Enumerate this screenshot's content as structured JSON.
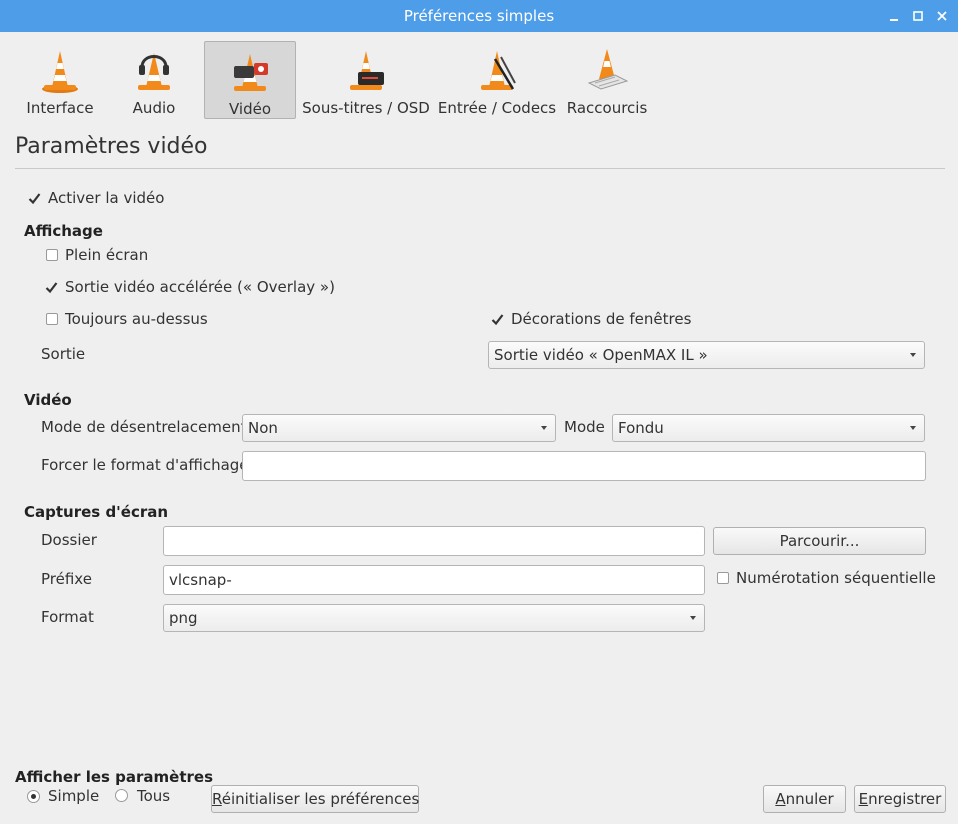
{
  "window": {
    "title": "Préférences simples"
  },
  "tabs": [
    {
      "label": "Interface",
      "icon": "vlc-cone-icon"
    },
    {
      "label": "Audio",
      "icon": "vlc-cone-headphones-icon"
    },
    {
      "label": "Vidéo",
      "icon": "vlc-cone-video-icon",
      "active": true
    },
    {
      "label": "Sous-titres / OSD",
      "icon": "vlc-cone-subtitles-icon"
    },
    {
      "label": "Entrée / Codecs",
      "icon": "vlc-cone-cables-icon"
    },
    {
      "label": "Raccourcis",
      "icon": "vlc-cone-keyboard-icon"
    }
  ],
  "section_title": "Paramètres vidéo",
  "enable_video": {
    "label": "Activer la vidéo",
    "checked": true
  },
  "display": {
    "title": "Affichage",
    "fullscreen": {
      "label": "Plein écran",
      "checked": false
    },
    "overlay": {
      "label": "Sortie vidéo accélérée (« Overlay »)",
      "checked": true
    },
    "always_on_top": {
      "label": "Toujours au-dessus",
      "checked": false
    },
    "window_decorations": {
      "label": "Décorations de fenêtres",
      "checked": true
    },
    "output_label": "Sortie",
    "output_value": "Sortie vidéo « OpenMAX IL »"
  },
  "video": {
    "title": "Vidéo",
    "deinterlace_label": "Mode de désentrelacement",
    "deinterlace_value": "Non",
    "mode_label": "Mode",
    "mode_value": "Fondu",
    "aspect_label": "Forcer le format d'affichage",
    "aspect_value": ""
  },
  "snapshots": {
    "title": "Captures d'écran",
    "folder_label": "Dossier",
    "folder_value": "",
    "browse_label": "Parcourir...",
    "prefix_label": "Préfixe",
    "prefix_value": "vlcsnap-",
    "sequential_label": "Numérotation séquentielle",
    "sequential_checked": false,
    "format_label": "Format",
    "format_value": "png"
  },
  "footer": {
    "show_settings_label": "Afficher les paramètres",
    "simple_label": "Simple",
    "all_label": "Tous",
    "reset_label_pre": "R",
    "reset_label_rest": "éinitialiser les préférences",
    "cancel_label_pre": "A",
    "cancel_label_rest": "nnuler",
    "save_label_pre": "E",
    "save_label_rest": "nregistrer"
  },
  "colors": {
    "titlebar": "#4d9de9",
    "background": "#efefef",
    "cone_orange": "#f28a1b"
  }
}
